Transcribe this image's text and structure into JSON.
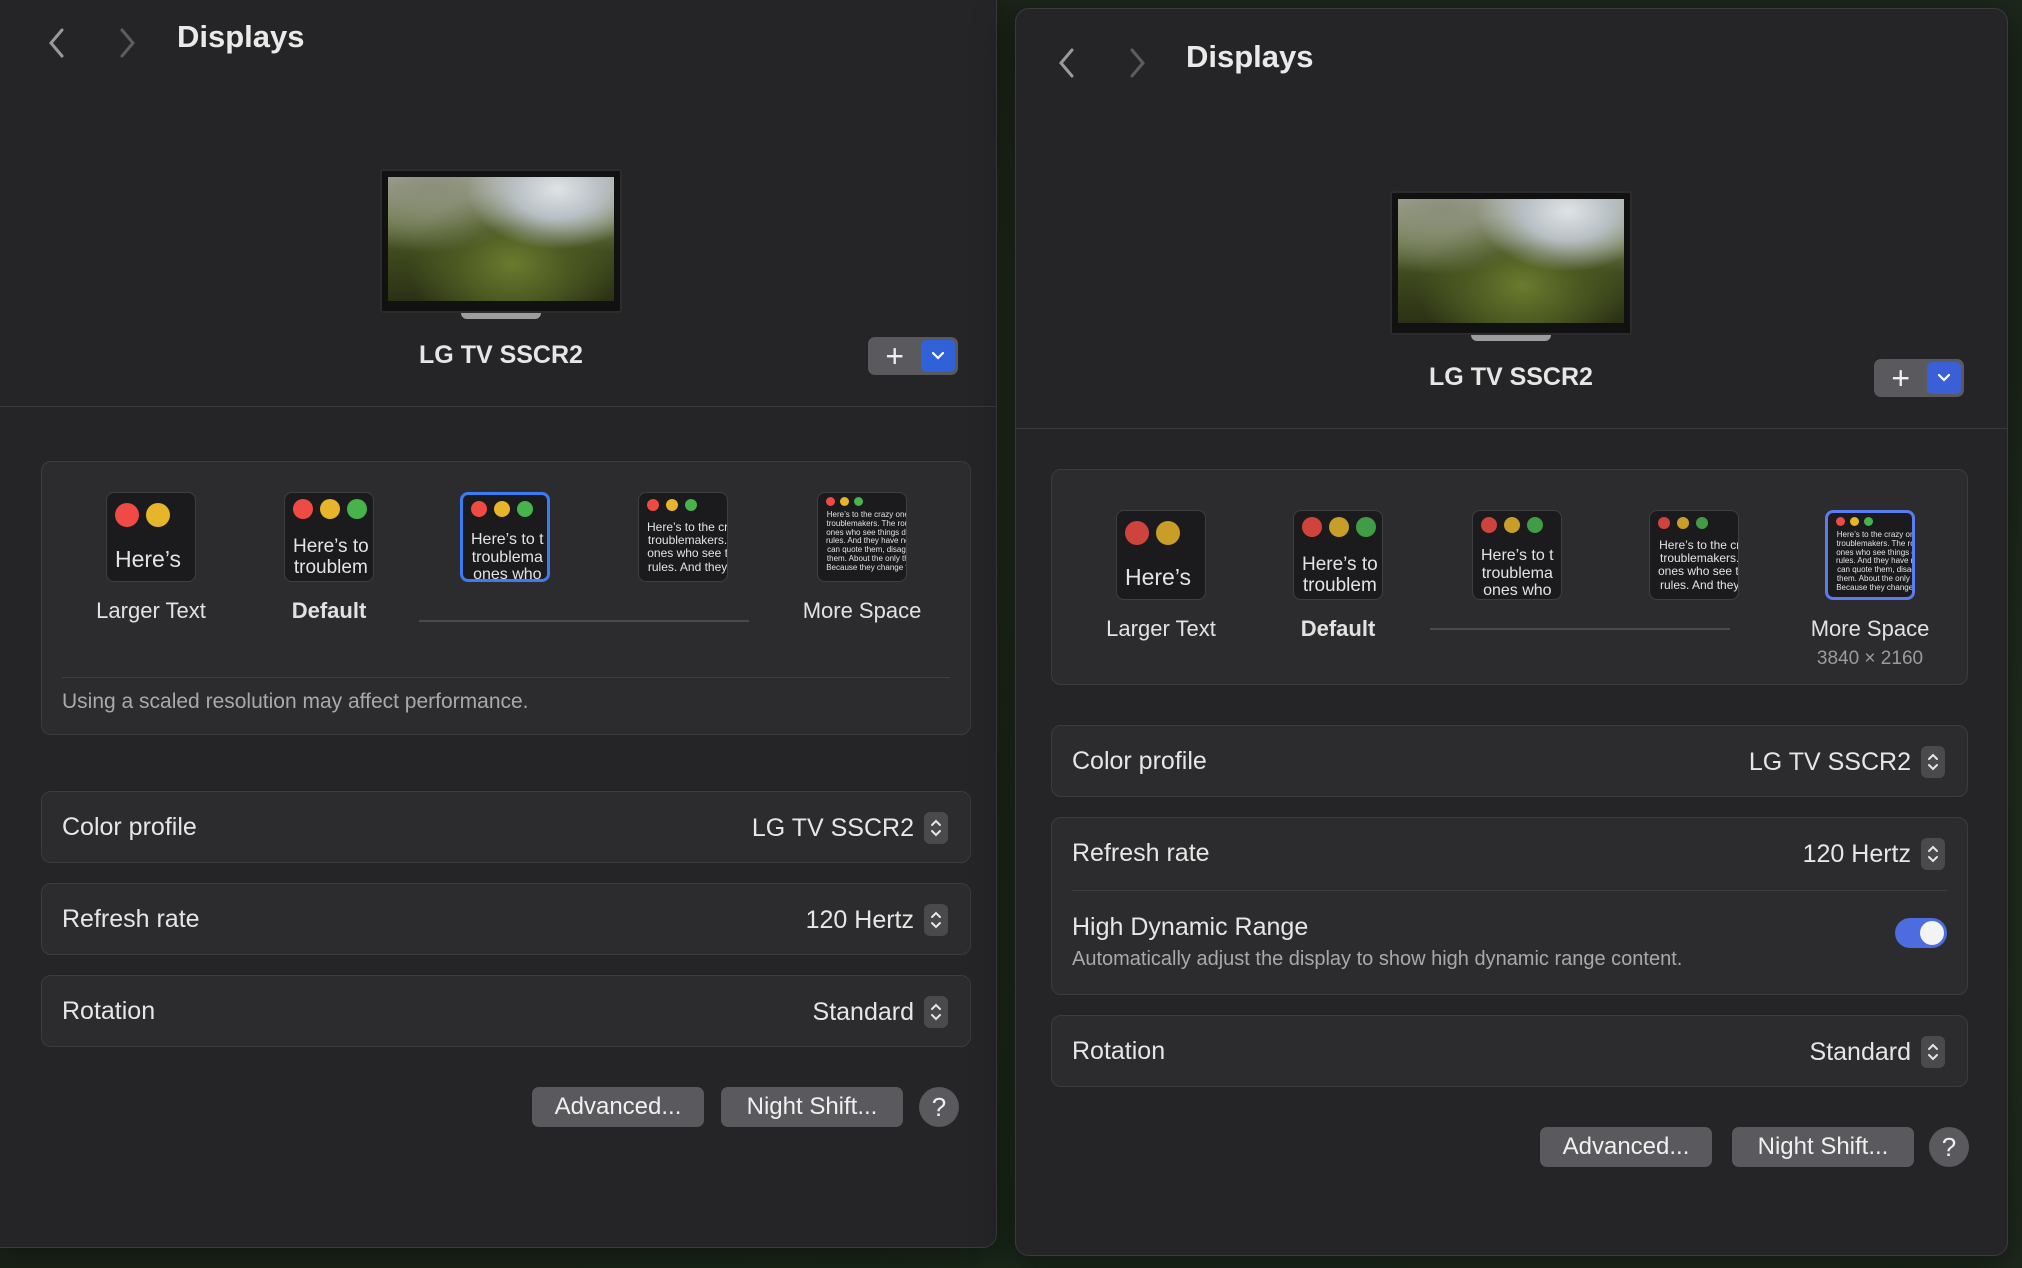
{
  "left": {
    "title": "Displays",
    "display_name": "LG TV SSCR2",
    "add_label": "+",
    "resolution": {
      "options": [
        {
          "preview": "Here’s",
          "label": "Larger Text"
        },
        {
          "preview": "Here’s to\ntroublem",
          "label": "Default"
        },
        {
          "preview": "Here’s to t\ntroublema\nones who",
          "label": ""
        },
        {
          "preview": "Here’s to the cr\ntroublemakers.\nones who see t\nrules. And they",
          "label": ""
        },
        {
          "preview": "Here’s to the crazy one\ntroublemakers. The rou\nones who see things dil\nrules. And they have no\ncan quote them, disagr\nthem. About the only th\nBecause they change tl",
          "label": "More Space"
        }
      ],
      "note": "Using a scaled resolution may affect performance."
    },
    "rows": {
      "color_profile": {
        "label": "Color profile",
        "value": "LG TV SSCR2"
      },
      "refresh_rate": {
        "label": "Refresh rate",
        "value": "120 Hertz"
      },
      "rotation": {
        "label": "Rotation",
        "value": "Standard"
      }
    },
    "buttons": {
      "advanced": "Advanced...",
      "night_shift": "Night Shift...",
      "help": "?"
    }
  },
  "right": {
    "title": "Displays",
    "display_name": "LG TV SSCR2",
    "add_label": "+",
    "resolution": {
      "options": [
        {
          "preview": "Here’s",
          "label": "Larger Text"
        },
        {
          "preview": "Here’s to\ntroublem",
          "label": "Default"
        },
        {
          "preview": "Here’s to t\ntroublema\nones who",
          "label": ""
        },
        {
          "preview": "Here’s to the cr\ntroublemakers.\nones who see tl\nrules. And they",
          "label": ""
        },
        {
          "preview": "Here’s to the crazy one\ntroublemakers. The rou\nones who see things dil\nrules. And they have no\ncan quote them, disagr\nthem. About the only th\nBecause they change tl",
          "label": "More Space",
          "sub": "3840 × 2160"
        }
      ]
    },
    "rows": {
      "color_profile": {
        "label": "Color profile",
        "value": "LG TV SSCR2"
      },
      "refresh_rate": {
        "label": "Refresh rate",
        "value": "120 Hertz"
      },
      "hdr": {
        "label": "High Dynamic Range",
        "description": "Automatically adjust the display to show high dynamic range content.",
        "enabled": true
      },
      "rotation": {
        "label": "Rotation",
        "value": "Standard"
      }
    },
    "buttons": {
      "advanced": "Advanced...",
      "night_shift": "Night Shift...",
      "help": "?"
    }
  },
  "colors": {
    "accent": "#3b7cf5",
    "toggle_on": "#4b6de0",
    "window_bg": "#252527",
    "group_bg": "#2c2c2e"
  },
  "icons": [
    "chevron-left-icon",
    "chevron-right-icon",
    "plus-icon",
    "chevron-down-icon",
    "stepper-icon",
    "question-icon"
  ]
}
